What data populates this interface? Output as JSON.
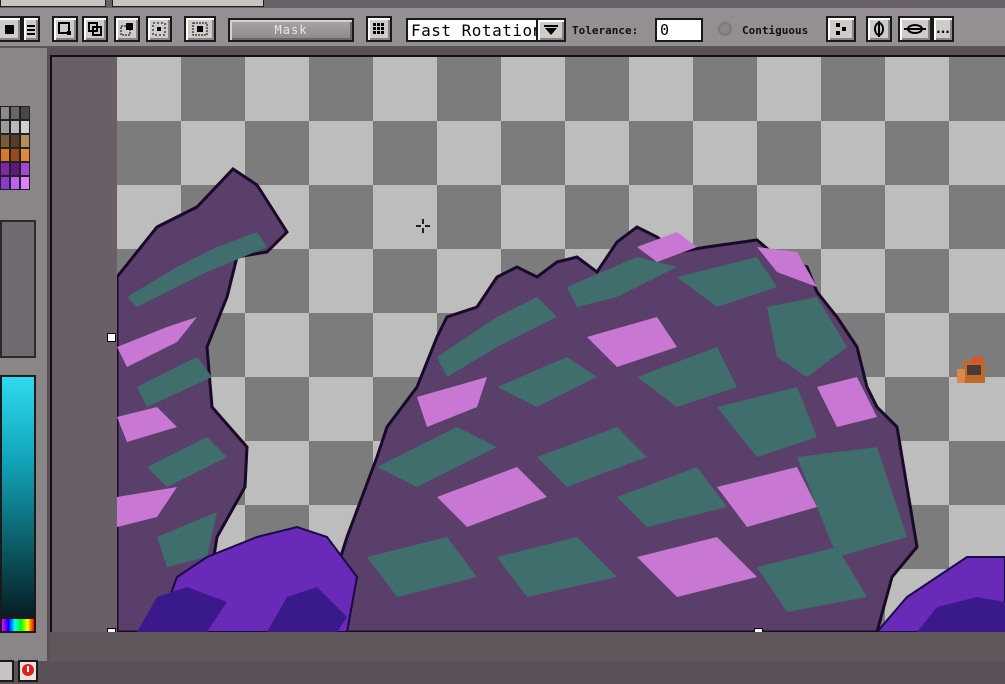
{
  "toolbar": {
    "mask_label": "Mask",
    "rotation_mode": "Fast Rotation",
    "tolerance_label": "Tolerance:",
    "tolerance_value": "0",
    "contiguous_label": "Contiguous",
    "more_label": "..."
  },
  "icons": [
    "solid-square-icon",
    "lines-icon",
    "rect-select-icon",
    "shape-select-icon",
    "magic-select-icon",
    "grid-select-icon",
    "lasso-select-icon",
    "grid-icon",
    "dropdown-arrow-icon",
    "contiguous-radio-icon",
    "transform-icon",
    "flip-h-icon",
    "flip-v-icon"
  ],
  "palette_colors": [
    "#8a8888",
    "#6a6668",
    "#4a4648",
    "#9a9a9a",
    "#b8b8b8",
    "#d0d0d0",
    "#7a5c3a",
    "#5a3a28",
    "#b0905a",
    "#d67a28",
    "#9a4a1a",
    "#e08a3a",
    "#7a2aa8",
    "#5a1a80",
    "#a04ad0",
    "#8a3ad0",
    "#c060f0",
    "#e080ff"
  ],
  "colors": {
    "accent_cyan": "#2fd9f0",
    "mountain_dark": "#5a3f6a",
    "mountain_teal": "#3f6e6c",
    "mountain_pink": "#c877d2",
    "deep_purple": "#3a1a8a"
  }
}
